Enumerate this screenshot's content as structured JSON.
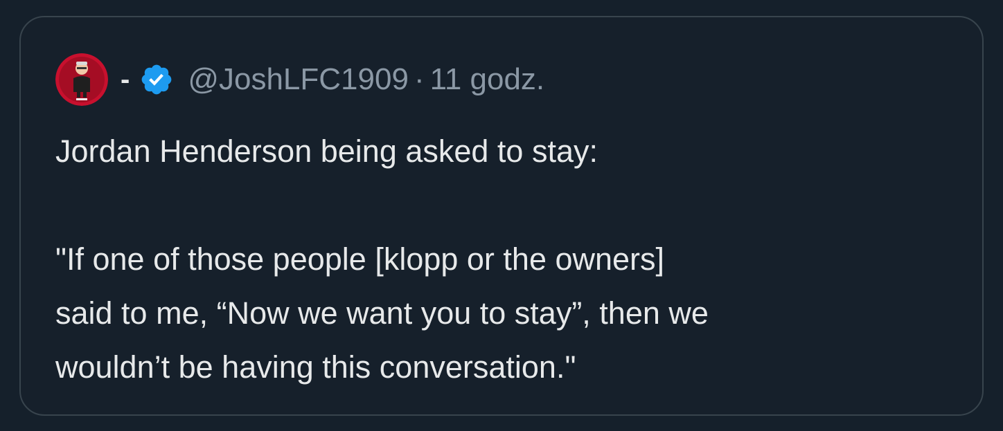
{
  "tweet": {
    "display_name": "-",
    "handle": "@JoshLFC1909",
    "separator": "·",
    "time": "11 godz.",
    "verified_badge_icon": "verified-badge-icon",
    "avatar_icon": "avatar-image",
    "badge_color": "#1d9bf0",
    "avatar_color": "#c8102e",
    "text_lines": [
      "Jordan Henderson being asked to stay:",
      "",
      "\"If one of those people [klopp or the owners]",
      "said to me, “Now we want you to stay”, then we",
      "wouldn’t be having this conversation.\""
    ]
  }
}
